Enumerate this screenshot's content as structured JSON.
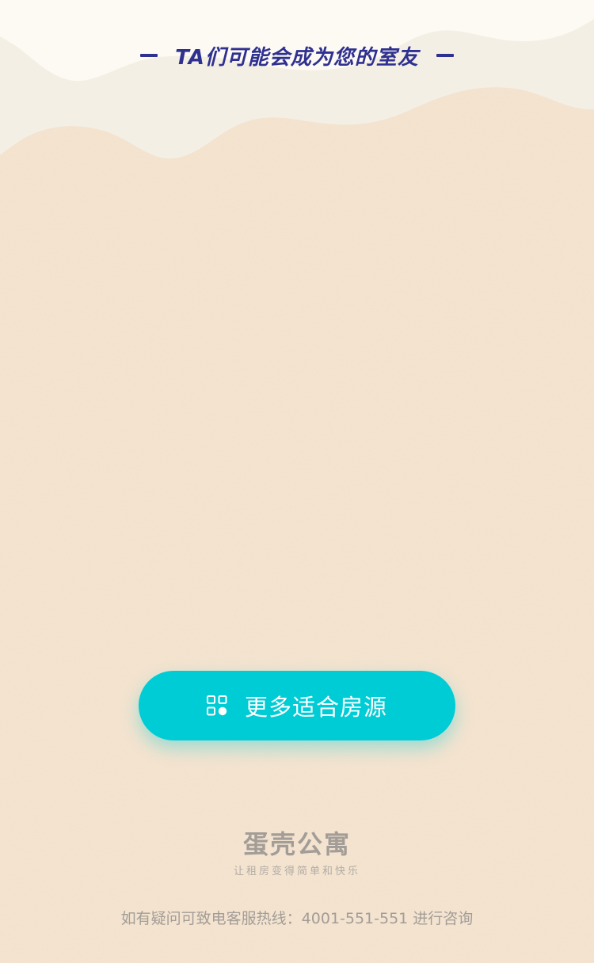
{
  "header": {
    "title": "TA们可能会成为您的室友"
  },
  "cta": {
    "label": "更多适合房源",
    "icon": "grid-apps-icon"
  },
  "brand": {
    "name": "蛋壳公寓",
    "slogan": "让租房变得简单和快乐"
  },
  "footer": {
    "hotline": "如有疑问可致电客服热线：4001-551-551 进行咨询"
  },
  "colors": {
    "background": "#f5e5d1",
    "top_wave_light": "#fdfaf3",
    "top_wave_mid": "#f4efe4",
    "title": "#2f3190",
    "accent": "#00ccd6",
    "muted_text": "#a39d97"
  }
}
